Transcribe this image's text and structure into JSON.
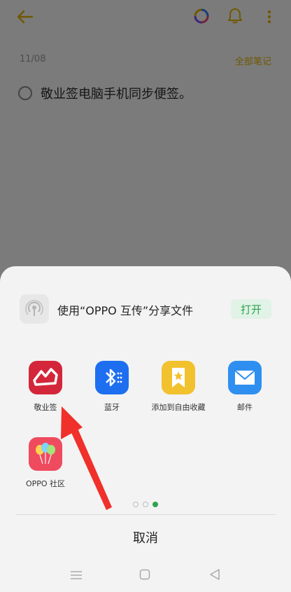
{
  "note": {
    "date": "11/08",
    "all_notes_label": "全部笔记",
    "todo_text": "敬业签电脑手机同步便签。"
  },
  "icons": {
    "back": "back-arrow-icon",
    "ring": "color-ring-icon",
    "bell": "bell-icon",
    "more": "more-icon"
  },
  "share_sheet": {
    "share_text": "使用“OPPO 互传”分享文件",
    "open_label": "打开",
    "apps": [
      {
        "label": "敬业签",
        "icon": "jingyeqian-app-icon",
        "color": "#d4263a"
      },
      {
        "label": "蓝牙",
        "icon": "bluetooth-icon",
        "color": "#1e6ff0"
      },
      {
        "label": "添加到自由收藏",
        "icon": "favorites-icon",
        "color": "#f2c12e"
      },
      {
        "label": "邮件",
        "icon": "mail-icon",
        "color": "#2f8ff0"
      },
      {
        "label": "OPPO 社区",
        "icon": "oppo-community-icon",
        "color": "#ef4b5f"
      }
    ],
    "page_dots": {
      "count": 3,
      "active": 3
    },
    "cancel_label": "取消"
  },
  "colors": {
    "accent": "#e0b000",
    "open_button": "#2ea44f",
    "annotation_arrow": "#f0302a"
  }
}
